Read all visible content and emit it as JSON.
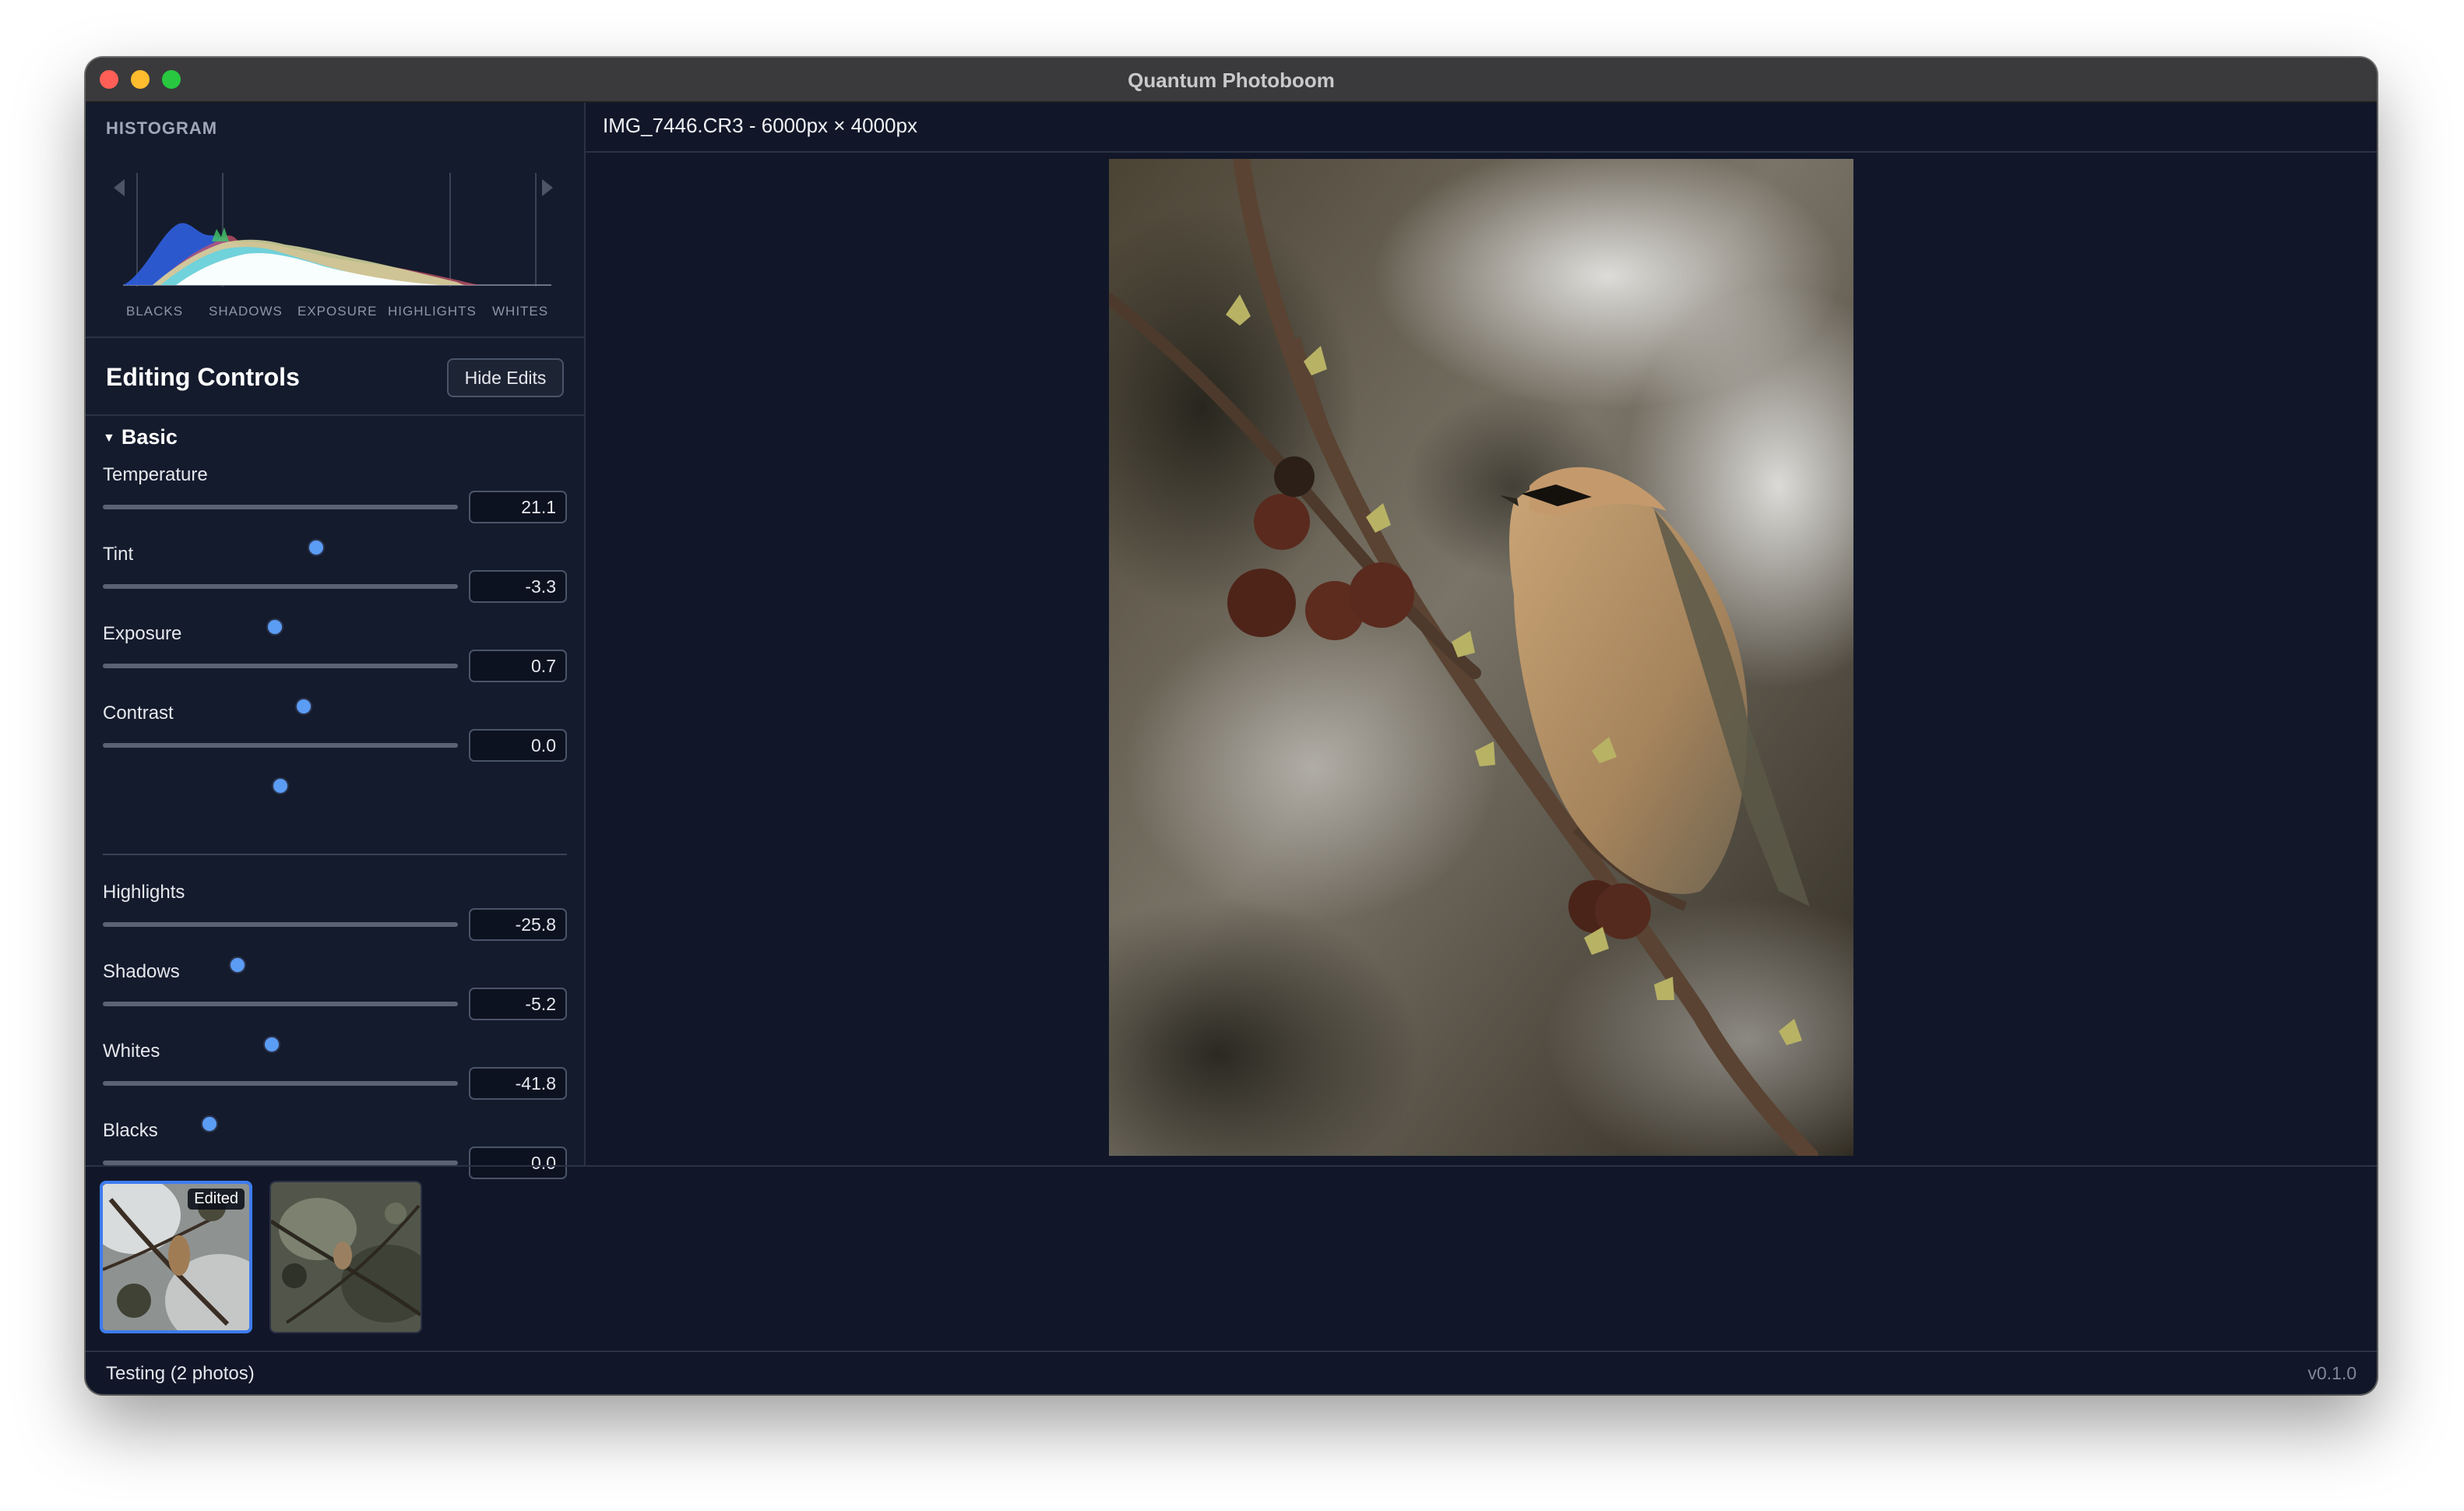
{
  "window": {
    "title": "Quantum Photoboom"
  },
  "histogram": {
    "title": "HISTOGRAM",
    "labels": [
      "BLACKS",
      "SHADOWS",
      "EXPOSURE",
      "HIGHLIGHTS",
      "WHITES"
    ]
  },
  "editing": {
    "title": "Editing Controls",
    "hide_button": "Hide Edits"
  },
  "basic": {
    "title": "Basic",
    "controls": [
      {
        "label": "Temperature",
        "value": "21.1",
        "position": 0.6
      },
      {
        "label": "Tint",
        "value": "-3.3",
        "position": 0.485
      },
      {
        "label": "Exposure",
        "value": "0.7",
        "position": 0.565
      },
      {
        "label": "Contrast",
        "value": "0.0",
        "position": 0.5
      },
      {
        "label": "Highlights",
        "value": "-25.8",
        "position": 0.38
      },
      {
        "label": "Shadows",
        "value": "-5.2",
        "position": 0.475
      },
      {
        "label": "Whites",
        "value": "-41.8",
        "position": 0.3
      },
      {
        "label": "Blacks",
        "value": "0.0",
        "position": 0.5
      }
    ]
  },
  "image": {
    "header": "IMG_7446.CR3 - 6000px × 4000px"
  },
  "filmstrip": {
    "badge": "Edited"
  },
  "status": {
    "left": "Testing (2 photos)",
    "right": "v0.1.0"
  },
  "colors": {
    "accent": "#5b9cf5",
    "selection": "#3d7cf0",
    "background": "#111729"
  },
  "icons": {
    "histogram_left": "triangle-left-icon",
    "histogram_right": "triangle-right-icon",
    "section_toggle": "caret-down-icon"
  }
}
